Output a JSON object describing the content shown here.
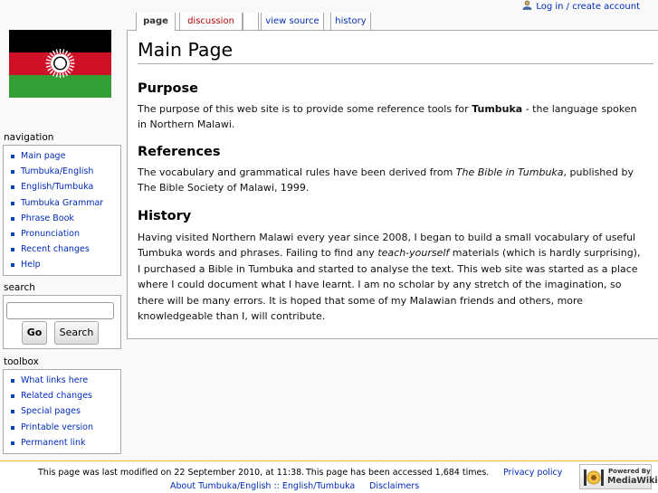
{
  "personal": {
    "login_label": "Log in / create account"
  },
  "tabs": [
    {
      "label": "page",
      "selected": true
    },
    {
      "label": "discussion",
      "red": true
    },
    {
      "label": ""
    },
    {
      "label": "view source"
    },
    {
      "label": "history"
    }
  ],
  "navigation": {
    "title": "navigation",
    "items": [
      "Main page",
      "Tumbuka/English",
      "English/Tumbuka",
      "Tumbuka Grammar",
      "Phrase Book",
      "Pronunciation",
      "Recent changes",
      "Help"
    ]
  },
  "search": {
    "title": "search",
    "go_label": "Go",
    "search_label": "Search",
    "value": ""
  },
  "toolbox": {
    "title": "toolbox",
    "items": [
      "What links here",
      "Related changes",
      "Special pages",
      "Printable version",
      "Permanent link"
    ]
  },
  "content": {
    "title": "Main Page",
    "sections": [
      {
        "heading": "Purpose",
        "text_before": "The purpose of this web site is to provide some reference tools for ",
        "bold": "Tumbuka",
        "text_after": " - the language spoken in Northern Malawi."
      },
      {
        "heading": "References",
        "text_before": "The vocabulary and grammatical rules have been derived from ",
        "italic": "The Bible in Tumbuka",
        "text_after": ", published by The Bible Society of Malawi, 1999."
      },
      {
        "heading": "History",
        "text_before": "Having visited Northern Malawi every year since 2008, I began to build a small vocabulary of useful Tumbuka words and phrases. Failing to find any ",
        "italic": "teach-yourself",
        "text_after": " materials (which is hardly surprising), I purchased a Bible in Tumbuka and started to analyse the text. This web site was started as a place where I could document what I have learnt. I am no scholar by any stretch of the imagination, so there will be many errors. It is hoped that some of my Malawian friends and others, more knowledgeable than I, will contribute."
      }
    ]
  },
  "footer": {
    "last_modified": "This page was last modified on 22 September 2010, at 11:38.",
    "accessed": "This page has been accessed 1,684 times.",
    "privacy": "Privacy policy",
    "about": "About Tumbuka/English :: English/Tumbuka",
    "disclaimers": "Disclaimers",
    "badge_top": "Powered By",
    "badge_bottom": "MediaWiki"
  },
  "colors": {
    "link": "#002bb8",
    "red_link": "#ba0000",
    "border": "#aaaaaa",
    "footer_rule": "#fabd23",
    "flag_black": "#000000",
    "flag_red": "#ce1126",
    "flag_green": "#339e35"
  }
}
